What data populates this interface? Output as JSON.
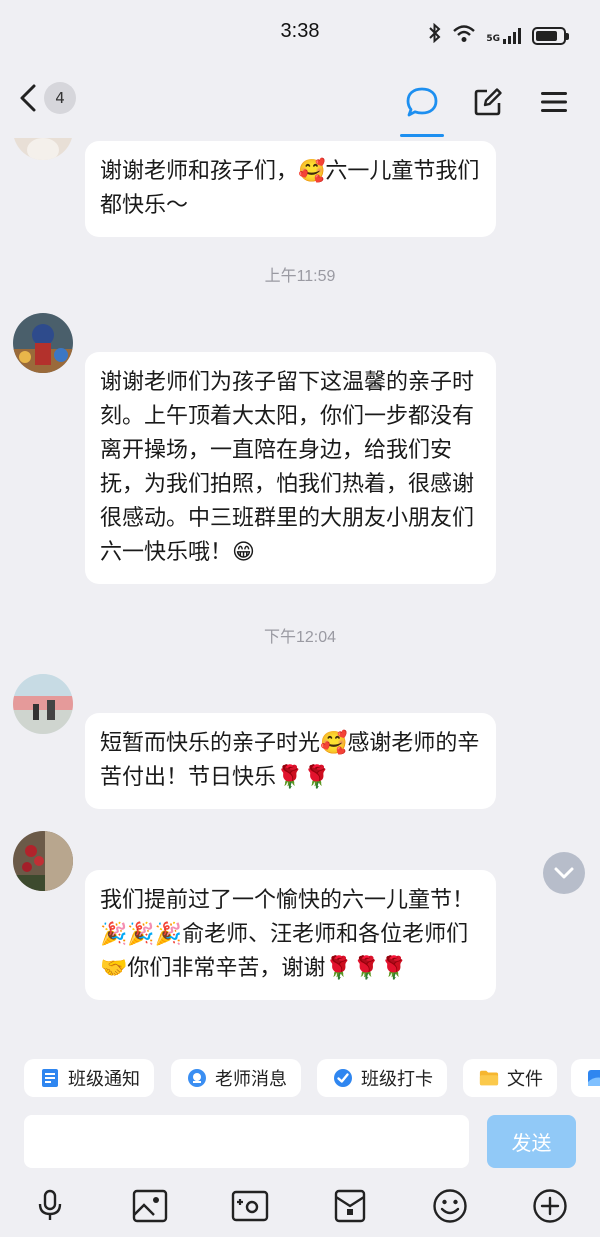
{
  "status_bar": {
    "time": "3:38",
    "network": "5G",
    "battery_level": 0.8
  },
  "nav": {
    "back_count": "4"
  },
  "timestamps": [
    "上午11:59",
    "下午12:04"
  ],
  "messages": [
    {
      "text": "谢谢老师和孩子们，🥰六一儿童节我们都快乐～"
    },
    {
      "text": "谢谢老师们为孩子留下这温馨的亲子时刻。上午顶着大太阳，你们一步都没有离开操场，一直陪在身边，给我们安抚，为我们拍照，怕我们热着，很感谢很感动。中三班群里的大朋友小朋友们六一快乐哦！😁"
    },
    {
      "text": "短暂而快乐的亲子时光🥰感谢老师的辛苦付出！节日快乐🌹🌹"
    },
    {
      "text": "我们提前过了一个愉快的六一儿童节！🎉🎉🎉俞老师、汪老师和各位老师们🤝你们非常辛苦，谢谢🌹🌹🌹"
    }
  ],
  "quick_actions": [
    {
      "label": "班级通知",
      "icon": "notice-icon"
    },
    {
      "label": "老师消息",
      "icon": "teacher-message-icon"
    },
    {
      "label": "班级打卡",
      "icon": "check-in-icon"
    },
    {
      "label": "文件",
      "icon": "folder-icon"
    }
  ],
  "input": {
    "placeholder": "",
    "send_label": "发送"
  },
  "toolbar": [
    "microphone-icon",
    "image-icon",
    "camera-icon",
    "red-packet-icon",
    "emoji-icon",
    "plus-icon"
  ],
  "colors": {
    "accent": "#1d8ff0",
    "send_disabled": "#91c9f7",
    "background": "#efeff3"
  }
}
